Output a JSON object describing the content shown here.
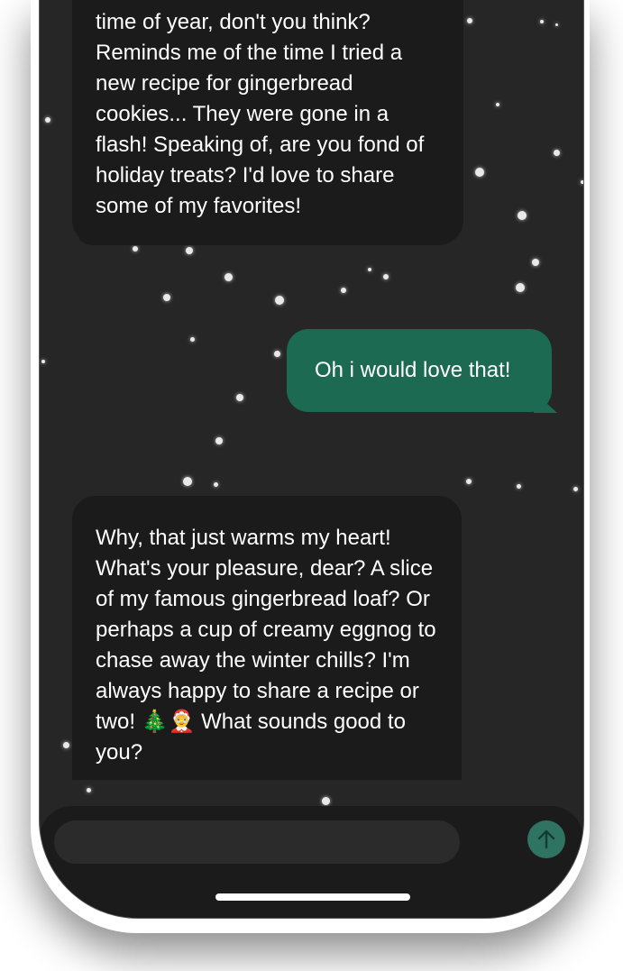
{
  "chat": {
    "messages": [
      {
        "role": "assistant",
        "text": "time of year, don't you think? Reminds me of the time I tried a new recipe for gingerbread cookies... They were gone in a flash! Speaking of, are you fond of holiday treats? I'd love to share some of my favorites!"
      },
      {
        "role": "user",
        "text": "Oh i would love that!"
      },
      {
        "role": "assistant",
        "text": "Why, that just warms my heart! What's your pleasure, dear? A slice of my famous gingerbread loaf? Or perhaps a cup of creamy eggnog to chase away the winter chills? I'm always happy to share a recipe or two! 🎄🤶 What sounds good to you?"
      }
    ]
  },
  "composer": {
    "input_value": "",
    "input_placeholder": "",
    "send_icon": "arrow-up-icon"
  },
  "colors": {
    "background": "#262626",
    "bot_bubble": "#1c1b1b",
    "user_bubble": "#1c6a52",
    "send_button": "#2f7362"
  }
}
